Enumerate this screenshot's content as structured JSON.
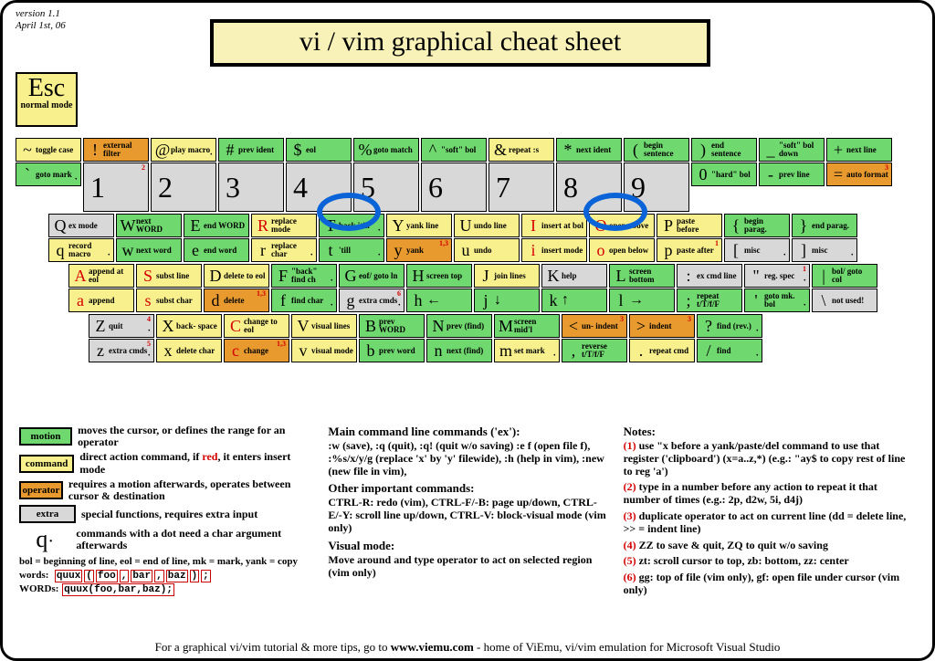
{
  "meta": {
    "version_line1": "version 1.1",
    "version_line2": "April 1st, 06",
    "title": "vi / vim graphical cheat sheet",
    "esc_key": "Esc",
    "esc_label": "normal mode"
  },
  "rows": [
    [
      {
        "s": {
          "g": "~",
          "t": "toggle case",
          "c": "command"
        },
        "u": {
          "g": "`",
          "t": "goto mark",
          "c": "motion",
          "dot": true
        }
      },
      {
        "s": {
          "g": "!",
          "t": "external filter",
          "c": "operator"
        },
        "u": {
          "g": "1",
          "t": "",
          "c": "extra",
          "tall": true,
          "note": "2"
        }
      },
      {
        "s": {
          "g": "@",
          "t": "play macro",
          "c": "command",
          "dot": true
        },
        "u": {
          "g": "2",
          "t": "",
          "c": "extra",
          "tall": true
        }
      },
      {
        "s": {
          "g": "#",
          "t": "prev ident",
          "c": "motion"
        },
        "u": {
          "g": "3",
          "t": "",
          "c": "extra",
          "tall": true
        }
      },
      {
        "s": {
          "g": "$",
          "t": "eol",
          "c": "motion"
        },
        "u": {
          "g": "4",
          "t": "",
          "c": "extra",
          "tall": true
        }
      },
      {
        "s": {
          "g": "%",
          "t": "goto match",
          "c": "motion"
        },
        "u": {
          "g": "5",
          "t": "",
          "c": "extra",
          "tall": true
        }
      },
      {
        "s": {
          "g": "^",
          "t": "\"soft\" bol",
          "c": "motion"
        },
        "u": {
          "g": "6",
          "t": "",
          "c": "extra",
          "tall": true
        }
      },
      {
        "s": {
          "g": "&",
          "t": "repeat :s",
          "c": "command"
        },
        "u": {
          "g": "7",
          "t": "",
          "c": "extra",
          "tall": true
        }
      },
      {
        "s": {
          "g": "*",
          "t": "next ident",
          "c": "motion"
        },
        "u": {
          "g": "8",
          "t": "",
          "c": "extra",
          "tall": true
        }
      },
      {
        "s": {
          "g": "(",
          "t": "begin sentence",
          "c": "motion"
        },
        "u": {
          "g": "9",
          "t": "",
          "c": "extra",
          "tall": true
        }
      },
      {
        "s": {
          "g": ")",
          "t": "end sentence",
          "c": "motion"
        },
        "u": {
          "g": "0",
          "t": "\"hard\" bol",
          "c": "motion"
        }
      },
      {
        "s": {
          "g": "_",
          "t": "\"soft\" bol down",
          "c": "motion"
        },
        "u": {
          "g": "-",
          "t": "prev line",
          "c": "motion"
        }
      },
      {
        "s": {
          "g": "+",
          "t": "next line",
          "c": "motion"
        },
        "u": {
          "g": "=",
          "t": "auto format",
          "c": "operator",
          "note": "3"
        }
      }
    ],
    [
      {
        "s": {
          "g": "Q",
          "t": "ex mode",
          "c": "extra"
        },
        "u": {
          "g": "q",
          "t": "record macro",
          "c": "command",
          "dot": true
        }
      },
      {
        "s": {
          "g": "W",
          "t": "next WORD",
          "c": "motion"
        },
        "u": {
          "g": "w",
          "t": "next word",
          "c": "motion"
        }
      },
      {
        "s": {
          "g": "E",
          "t": "end WORD",
          "c": "motion"
        },
        "u": {
          "g": "e",
          "t": "end word",
          "c": "motion"
        }
      },
      {
        "s": {
          "g": "R",
          "t": "replace mode",
          "c": "command",
          "ins": true
        },
        "u": {
          "g": "r",
          "t": "replace char",
          "c": "command",
          "dot": true
        }
      },
      {
        "s": {
          "g": "T",
          "t": "back 'till",
          "c": "motion",
          "dot": true
        },
        "u": {
          "g": "t",
          "t": "'till",
          "c": "motion",
          "dot": true
        }
      },
      {
        "s": {
          "g": "Y",
          "t": "yank line",
          "c": "command"
        },
        "u": {
          "g": "y",
          "t": "yank",
          "c": "operator",
          "note": "1,3"
        }
      },
      {
        "s": {
          "g": "U",
          "t": "undo line",
          "c": "command"
        },
        "u": {
          "g": "u",
          "t": "undo",
          "c": "command"
        }
      },
      {
        "s": {
          "g": "I",
          "t": "insert at bol",
          "c": "command",
          "ins": true
        },
        "u": {
          "g": "i",
          "t": "insert mode",
          "c": "command",
          "ins": true
        }
      },
      {
        "s": {
          "g": "O",
          "t": "open above",
          "c": "command",
          "ins": true
        },
        "u": {
          "g": "o",
          "t": "open below",
          "c": "command",
          "ins": true
        }
      },
      {
        "s": {
          "g": "P",
          "t": "paste before",
          "c": "command"
        },
        "u": {
          "g": "p",
          "t": "paste after",
          "c": "command",
          "note": "1"
        }
      },
      {
        "s": {
          "g": "{",
          "t": "begin parag.",
          "c": "motion"
        },
        "u": {
          "g": "[",
          "t": "misc",
          "c": "extra",
          "dot": true
        }
      },
      {
        "s": {
          "g": "}",
          "t": "end parag.",
          "c": "motion"
        },
        "u": {
          "g": "]",
          "t": "misc",
          "c": "extra",
          "dot": true
        }
      }
    ],
    [
      {
        "s": {
          "g": "A",
          "t": "append at eol",
          "c": "command",
          "ins": true
        },
        "u": {
          "g": "a",
          "t": "append",
          "c": "command",
          "ins": true
        }
      },
      {
        "s": {
          "g": "S",
          "t": "subst line",
          "c": "command",
          "ins": true
        },
        "u": {
          "g": "s",
          "t": "subst char",
          "c": "command",
          "ins": true
        }
      },
      {
        "s": {
          "g": "D",
          "t": "delete to eol",
          "c": "command"
        },
        "u": {
          "g": "d",
          "t": "delete",
          "c": "operator",
          "note": "1,3"
        }
      },
      {
        "s": {
          "g": "F",
          "t": "\"back\" find ch",
          "c": "motion",
          "dot": true
        },
        "u": {
          "g": "f",
          "t": "find char",
          "c": "motion",
          "dot": true
        }
      },
      {
        "s": {
          "g": "G",
          "t": "eof/ goto ln",
          "c": "motion"
        },
        "u": {
          "g": "g",
          "t": "extra cmds",
          "c": "extra",
          "dot": true,
          "note": "6"
        }
      },
      {
        "s": {
          "g": "H",
          "t": "screen top",
          "c": "motion"
        },
        "u": {
          "g": "h",
          "t": "←",
          "c": "motion",
          "arrow": true
        }
      },
      {
        "s": {
          "g": "J",
          "t": "join lines",
          "c": "command"
        },
        "u": {
          "g": "j",
          "t": "↓",
          "c": "motion",
          "arrow": true
        }
      },
      {
        "s": {
          "g": "K",
          "t": "help",
          "c": "extra"
        },
        "u": {
          "g": "k",
          "t": "↑",
          "c": "motion",
          "arrow": true
        }
      },
      {
        "s": {
          "g": "L",
          "t": "screen bottom",
          "c": "motion"
        },
        "u": {
          "g": "l",
          "t": "→",
          "c": "motion",
          "arrow": true
        }
      },
      {
        "s": {
          "g": ":",
          "t": "ex cmd line",
          "c": "extra"
        },
        "u": {
          "g": ";",
          "t": "repeat t/T/f/F",
          "c": "motion"
        }
      },
      {
        "s": {
          "g": "\"",
          "t": "reg. spec",
          "c": "extra",
          "dot": true,
          "note": "1"
        },
        "u": {
          "g": "'",
          "t": "goto mk. bol",
          "c": "motion",
          "dot": true
        }
      },
      {
        "s": {
          "g": "|",
          "t": "bol/ goto col",
          "c": "motion"
        },
        "u": {
          "g": "\\",
          "t": "not used!",
          "c": "extra"
        }
      }
    ],
    [
      {
        "s": {
          "g": "Z",
          "t": "quit",
          "c": "extra",
          "dot": true,
          "note": "4"
        },
        "u": {
          "g": "z",
          "t": "extra cmds",
          "c": "extra",
          "dot": true,
          "note": "5"
        }
      },
      {
        "s": {
          "g": "X",
          "t": "back- space",
          "c": "command"
        },
        "u": {
          "g": "x",
          "t": "delete char",
          "c": "command"
        }
      },
      {
        "s": {
          "g": "C",
          "t": "change to eol",
          "c": "command",
          "ins": true
        },
        "u": {
          "g": "c",
          "t": "change",
          "c": "operator",
          "ins": true,
          "note": "1,3"
        }
      },
      {
        "s": {
          "g": "V",
          "t": "visual lines",
          "c": "command"
        },
        "u": {
          "g": "v",
          "t": "visual mode",
          "c": "command"
        }
      },
      {
        "s": {
          "g": "B",
          "t": "prev WORD",
          "c": "motion"
        },
        "u": {
          "g": "b",
          "t": "prev word",
          "c": "motion"
        }
      },
      {
        "s": {
          "g": "N",
          "t": "prev (find)",
          "c": "motion"
        },
        "u": {
          "g": "n",
          "t": "next (find)",
          "c": "motion"
        }
      },
      {
        "s": {
          "g": "M",
          "t": "screen mid'l",
          "c": "motion"
        },
        "u": {
          "g": "m",
          "t": "set mark",
          "c": "command",
          "dot": true
        }
      },
      {
        "s": {
          "g": "<",
          "t": "un- indent",
          "c": "operator",
          "note": "3"
        },
        "u": {
          "g": ",",
          "t": "reverse t/T/f/F",
          "c": "motion"
        }
      },
      {
        "s": {
          "g": ">",
          "t": "indent",
          "c": "operator",
          "note": "3"
        },
        "u": {
          "g": ".",
          "t": "repeat cmd",
          "c": "command"
        }
      },
      {
        "s": {
          "g": "?",
          "t": "find (rev.)",
          "c": "motion",
          "dot": true
        },
        "u": {
          "g": "/",
          "t": "find",
          "c": "motion",
          "dot": true
        }
      }
    ]
  ],
  "legend": [
    {
      "swatch": "motion",
      "color": "motion",
      "text": "moves the cursor, or defines the range for an operator"
    },
    {
      "swatch": "command",
      "color": "command",
      "text": "direct action command, if red, it enters insert mode"
    },
    {
      "swatch": "operator",
      "color": "operator",
      "text": "requires a motion afterwards, operates between cursor & destination"
    },
    {
      "swatch": "extra",
      "color": "extra",
      "text": "special functions, requires extra input"
    }
  ],
  "qdot_text": "commands with a dot need a char argument afterwards",
  "defs": "bol = beginning of line, eol = end of line, mk = mark, yank = copy",
  "words_label": "words:",
  "WORDS_label": "WORDs:",
  "wordparts": [
    "quux",
    "(",
    "foo",
    ",",
    "bar",
    ",",
    "baz",
    ")",
    ";"
  ],
  "col2": {
    "h1": "Main command line commands ('ex'):",
    "p1": ":w (save), :q (quit), :q! (quit w/o saving) :e f (open file f), :%s/x/y/g (replace 'x' by 'y' filewide), :h (help in vim), :new (new file in vim),",
    "h2": "Other important commands:",
    "p2": "CTRL-R: redo (vim), CTRL-F/-B: page up/down, CTRL-E/-Y: scroll line up/down, CTRL-V: block-visual mode (vim only)",
    "h3": "Visual mode:",
    "p3": "Move around and type operator to act on selected region (vim only)"
  },
  "col3": {
    "title": "Notes:",
    "notes": [
      "use \"x before a yank/paste/del command to use that register ('clipboard') (x=a..z,*) (e.g.: \"ay$ to copy rest of line to reg 'a')",
      "type in a number before any action to repeat it that number of times (e.g.: 2p, d2w, 5i, d4j)",
      "duplicate operator to act on current line (dd = delete line, >> = indent line)",
      "ZZ to save & quit, ZQ to quit w/o saving",
      "zt: scroll cursor to top, zb: bottom, zz: center",
      "gg: top of file (vim only), gf: open file under cursor (vim only)"
    ]
  },
  "footer_pre": "For a graphical vi/vim tutorial & more tips, go to ",
  "footer_url": "www.viemu.com",
  "footer_post": " - home of ViEmu, vi/vim emulation for Microsoft Visual Studio"
}
